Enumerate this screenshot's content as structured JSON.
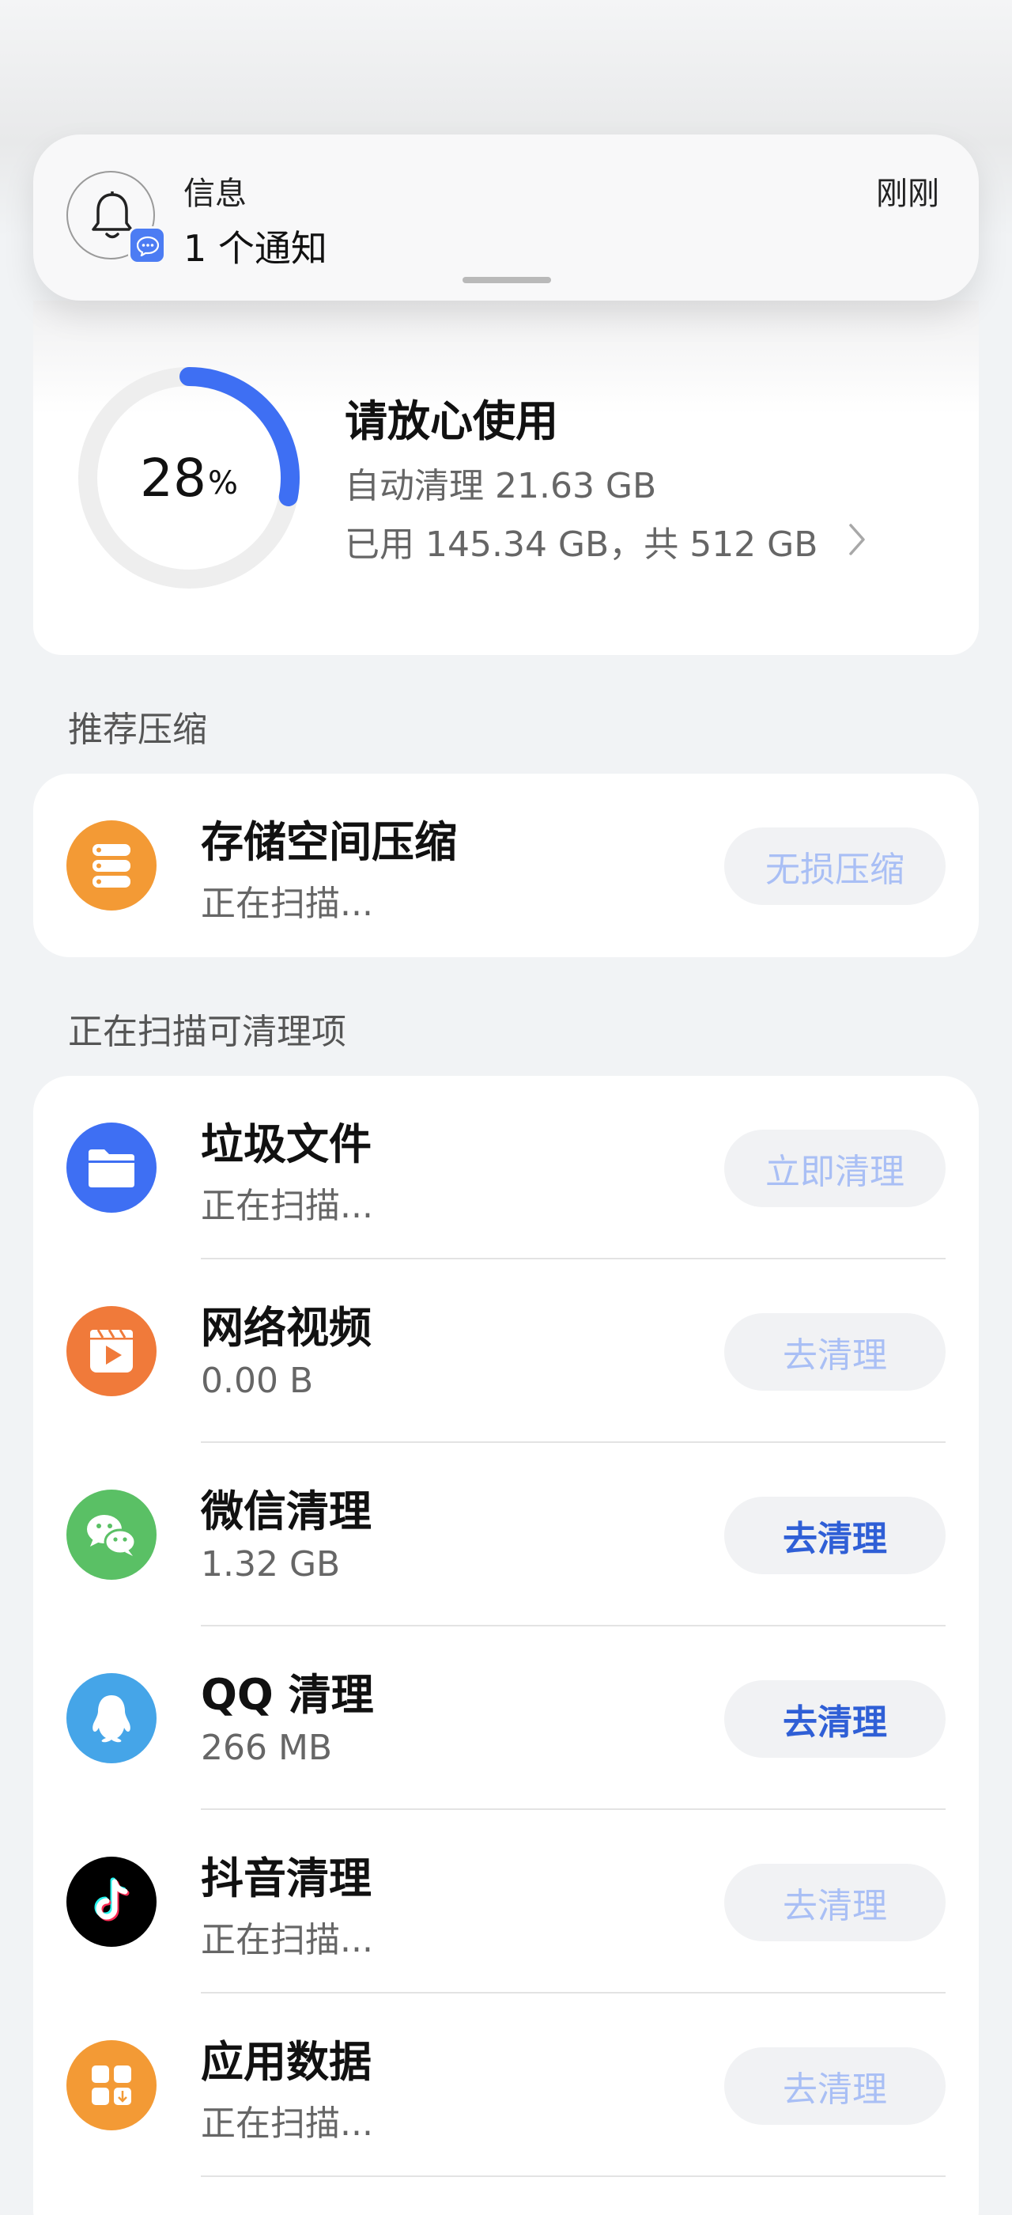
{
  "notification": {
    "app_name": "信息",
    "text": "1 个通知",
    "time": "刚刚"
  },
  "storage": {
    "percent": "28",
    "percent_sign": "%",
    "percent_value": 28,
    "status_title": "请放心使用",
    "auto_clean": "自动清理 21.63 GB",
    "usage": "已用 145.34 GB，共 512 GB",
    "ring_color": "#3e6ff3",
    "track_color": "#eeeeee"
  },
  "sections": {
    "compress_title": "推荐压缩",
    "scan_title": "正在扫描可清理项"
  },
  "compress": {
    "title": "存储空间压缩",
    "subtitle": "正在扫描...",
    "button": "无损压缩",
    "icon": "storage-stack-icon"
  },
  "items": [
    {
      "title": "垃圾文件",
      "subtitle": "正在扫描...",
      "button": "立即清理",
      "icon": "folder-icon",
      "color": "#3e6ff3",
      "active": false
    },
    {
      "title": "网络视频",
      "subtitle": "0.00 B",
      "button": "去清理",
      "icon": "video-play-icon",
      "color": "#f07a3a",
      "active": false
    },
    {
      "title": "微信清理",
      "subtitle": "1.32 GB",
      "button": "去清理",
      "icon": "wechat-icon",
      "color": "#5ac065",
      "active": true
    },
    {
      "title": "QQ 清理",
      "subtitle": "266 MB",
      "button": "去清理",
      "icon": "qq-penguin-icon",
      "color": "#45a5e8",
      "active": true
    },
    {
      "title": "抖音清理",
      "subtitle": "正在扫描...",
      "button": "去清理",
      "icon": "tiktok-icon",
      "color": "#000000",
      "active": false
    },
    {
      "title": "应用数据",
      "subtitle": "正在扫描...",
      "button": "去清理",
      "icon": "app-grid-icon",
      "color": "#f39a35",
      "active": false
    }
  ]
}
